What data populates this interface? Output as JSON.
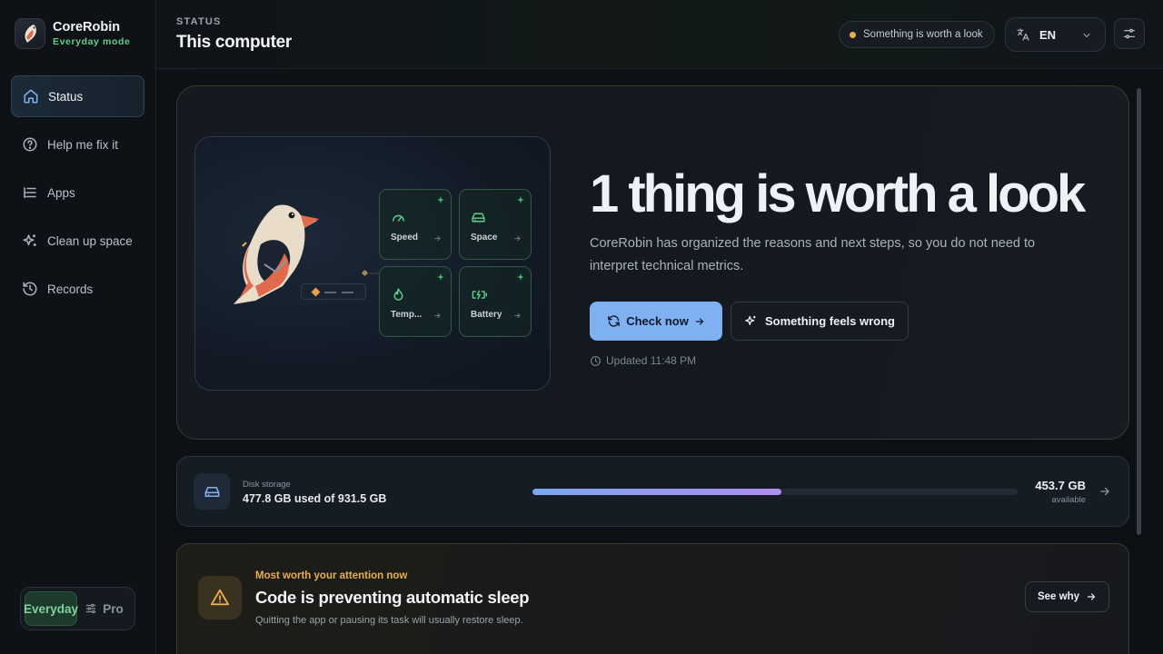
{
  "app": {
    "name": "CoreRobin",
    "mode_label": "Everyday mode"
  },
  "sidebar": {
    "items": [
      {
        "label": "Status",
        "icon": "home-icon",
        "active": true
      },
      {
        "label": "Help me fix it",
        "icon": "help-circle-icon"
      },
      {
        "label": "Apps",
        "icon": "list-icon"
      },
      {
        "label": "Clean up space",
        "icon": "sparkles-icon"
      },
      {
        "label": "Records",
        "icon": "history-icon"
      }
    ],
    "mode_switch": {
      "everyday": "Everyday",
      "pro": "Pro",
      "selected": "Everyday"
    }
  },
  "header": {
    "breadcrumb": "STATUS",
    "title": "This computer",
    "alert_pill": "Something is worth a look",
    "language": "EN"
  },
  "hero": {
    "tiles": [
      {
        "label": "Speed",
        "icon": "gauge-icon"
      },
      {
        "label": "Space",
        "icon": "drive-icon"
      },
      {
        "label": "Temp...",
        "icon": "flame-icon"
      },
      {
        "label": "Battery",
        "icon": "battery-charging-icon"
      }
    ],
    "title": "1 thing is worth a look",
    "description": "CoreRobin has organized the reasons and next steps, so you do not need to interpret technical metrics.",
    "primary_button": "Check now",
    "secondary_button": "Something feels wrong",
    "updated": "Updated 11:48 PM"
  },
  "disk": {
    "label": "Disk storage",
    "used_text": "477.8 GB used of 931.5 GB",
    "used_fraction": 0.513,
    "free": "453.7 GB",
    "free_label": "available"
  },
  "attention": {
    "kicker": "Most worth your attention now",
    "title": "Code is preventing automatic sleep",
    "subtitle": "Quitting the app or pausing its task will usually restore sleep.",
    "button": "See why"
  },
  "colors": {
    "accent": "#7fb0f2",
    "success": "#5fd08a",
    "warning": "#e8b04b"
  }
}
